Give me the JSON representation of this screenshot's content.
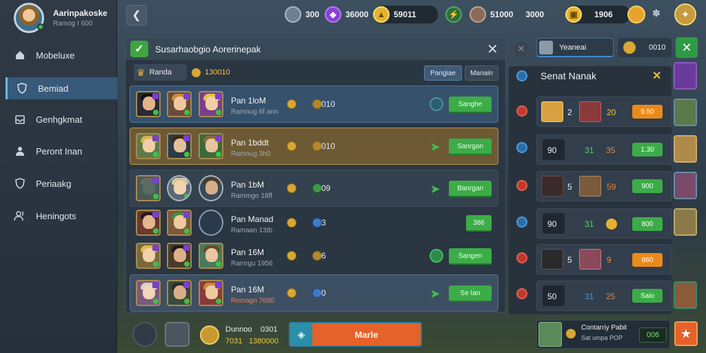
{
  "profile": {
    "name": "Aarinpakoske",
    "subtitle": "Ramog I 600"
  },
  "sidebar": {
    "items": [
      {
        "label": "Mobeluxe",
        "icon": "home-icon",
        "active": false
      },
      {
        "label": "Bemiad",
        "icon": "shield-icon",
        "active": true
      },
      {
        "label": "Genhgkmat",
        "icon": "inbox-icon",
        "active": false
      },
      {
        "label": "Peront Inan",
        "icon": "person-icon",
        "active": false
      },
      {
        "label": "Periaakg",
        "icon": "shield-icon",
        "active": false
      },
      {
        "label": "Heningots",
        "icon": "people-icon",
        "active": false
      }
    ]
  },
  "resources": [
    {
      "value": "300",
      "icon": "avatar-icon"
    },
    {
      "value": "36000",
      "icon": "gem-icon"
    },
    {
      "value": "59011",
      "icon": "gold-icon"
    },
    {
      "value": "",
      "icon": "energy-icon"
    },
    {
      "value": "51000",
      "icon": "avatar-icon"
    },
    {
      "value": "3000",
      "icon": "separator"
    },
    {
      "value": "1906",
      "icon": "chest-icon"
    }
  ],
  "panel": {
    "title": "Susarhaobgio Aorerinepak",
    "chip_label": "Randa",
    "chip_value": "130010",
    "tab1": "Pangiae",
    "tab2": "Manain",
    "rows": [
      {
        "name": "Pan 1loM",
        "sub": "Ramnug 6f ann",
        "val": "010",
        "btn": "Sanghe"
      },
      {
        "name": "Pan 1bddt",
        "sub": "Ramnug 3h0",
        "val": "010",
        "btn": "Sanrgan"
      },
      {
        "name": "Pan 1bM",
        "sub": "Rammgo 18ff",
        "val": "09",
        "btn": "Banrgan"
      },
      {
        "name": "Pan Manad",
        "sub": "Ramaan 13tb",
        "val": "3",
        "btn": "386"
      },
      {
        "name": "Pan 16M",
        "sub": "Ramrgu 1956",
        "val": "6",
        "btn": "Sangen"
      },
      {
        "name": "Pan 16M",
        "sub": "Remagn 7680",
        "val": "0",
        "btn": "Se tan"
      }
    ]
  },
  "bottom": {
    "name": "Dunnoo",
    "name_val": "0301",
    "stat": "7031",
    "stat_val": "1380000",
    "match_label": "Marle"
  },
  "right": {
    "tab_label": "Yeaneai",
    "tab_value": "0010",
    "title": "Senat Nanak",
    "rows": [
      {
        "a": "2",
        "b": "20",
        "pill": "9.50",
        "pill_color": "#e98a1c"
      },
      {
        "a": "90",
        "b": "31",
        "c": "35",
        "pill": "1.30",
        "pill_color": "#3cac48"
      },
      {
        "a": "5",
        "b": "59",
        "pill": "900",
        "pill_color": "#3cac48"
      },
      {
        "a": "90",
        "b": "31",
        "pill": "800",
        "pill_color": "#3cac48"
      },
      {
        "a": "5",
        "b": "9",
        "pill": "860",
        "pill_color": "#e98a1c"
      },
      {
        "a": "50",
        "b": "31",
        "c": "25",
        "pill": "Saio",
        "pill_color": "#3cac48"
      }
    ]
  },
  "footer_card": {
    "title": "Contarriy Pabit",
    "sub": "Sat umpa POP",
    "value": "006"
  }
}
